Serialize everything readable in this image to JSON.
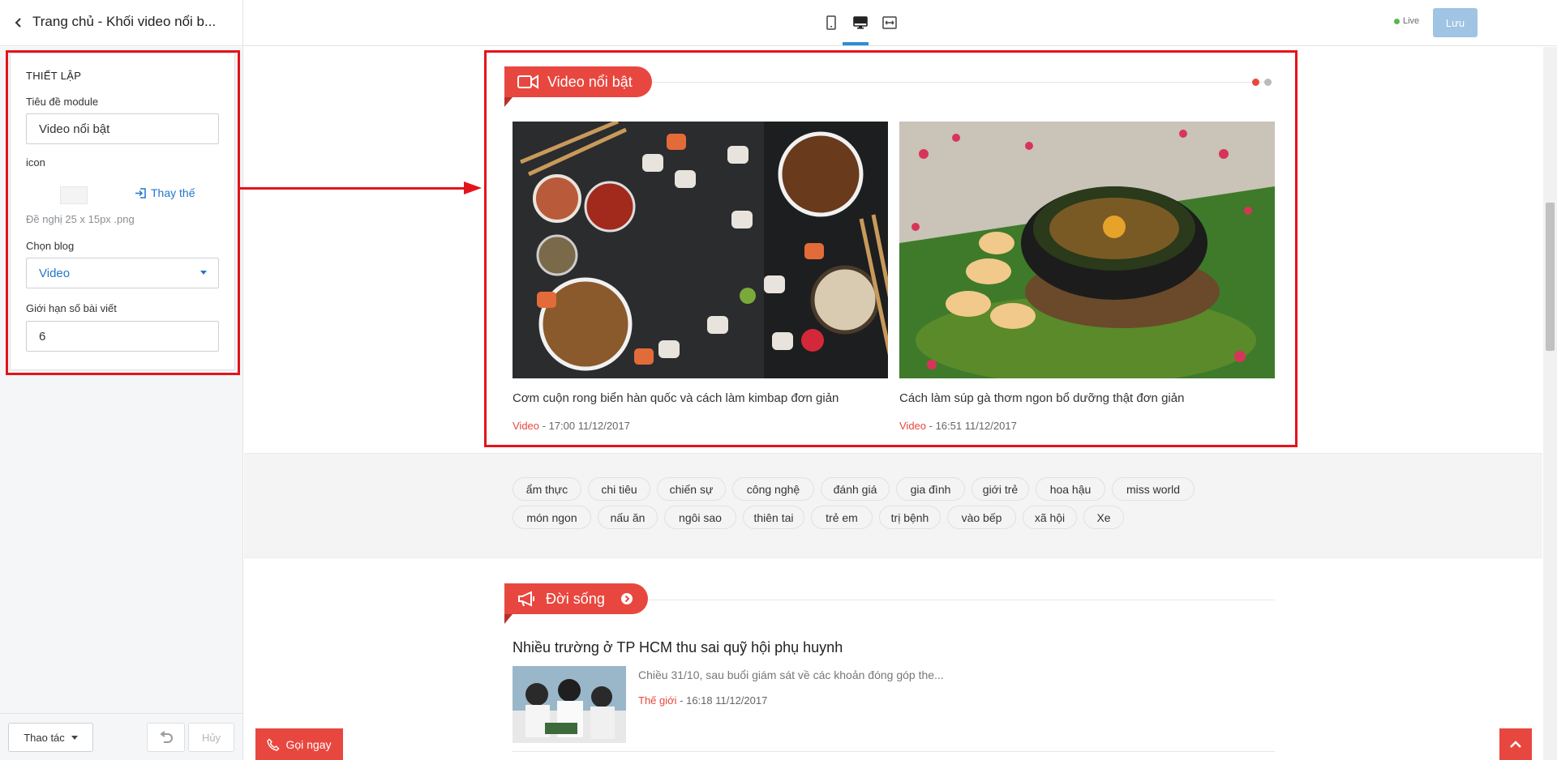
{
  "header": {
    "title": "Trang chủ - Khối video nổi b...",
    "live_label": "Live",
    "save_label": "Lưu"
  },
  "settings": {
    "section_title": "THIẾT LẬP",
    "module_title_label": "Tiêu đề module",
    "module_title_value": "Video nổi bật",
    "icon_label": "icon",
    "replace_label": "Thay thế",
    "icon_hint": "Đề nghị 25 x 15px .png",
    "blog_label": "Chọn blog",
    "blog_value": "Video",
    "limit_label": "Giới hạn số bài viết",
    "limit_value": "6"
  },
  "footer": {
    "actions_label": "Thao tác",
    "cancel_label": "Hủy"
  },
  "video_block": {
    "heading": "Video nổi bật",
    "items": [
      {
        "title": "Cơm cuộn rong biển hàn quốc và cách làm kimbap đơn giản",
        "category": "Video",
        "time": " - 17:00 11/12/2017"
      },
      {
        "title": "Cách làm súp gà thơm ngon bổ dưỡng thật đơn giản",
        "category": "Video",
        "time": " - 16:51 11/12/2017"
      }
    ]
  },
  "tags": [
    "ẩm thực",
    "chi tiêu",
    "chiến sự",
    "công nghệ",
    "đánh giá",
    "gia đình",
    "giới trẻ",
    "hoa hậu",
    "miss world",
    "món ngon",
    "nấu ăn",
    "ngôi sao",
    "thiên tai",
    "trẻ em",
    "trị bệnh",
    "vào bếp",
    "xã hội",
    "Xe"
  ],
  "life_block": {
    "heading": "Đời sống",
    "news_title": "Nhiều trường ở TP HCM thu sai quỹ hội phụ huynh",
    "news_excerpt": "Chiều 31/10, sau buổi giám sát về các khoản đóng góp the...",
    "news_category": "Thế giới",
    "news_time": " - 16:18 11/12/2017"
  },
  "call_label": "Gọi ngay",
  "colors": {
    "accent": "#e8473f",
    "link": "#2077cc",
    "annotation": "#e4141b"
  }
}
